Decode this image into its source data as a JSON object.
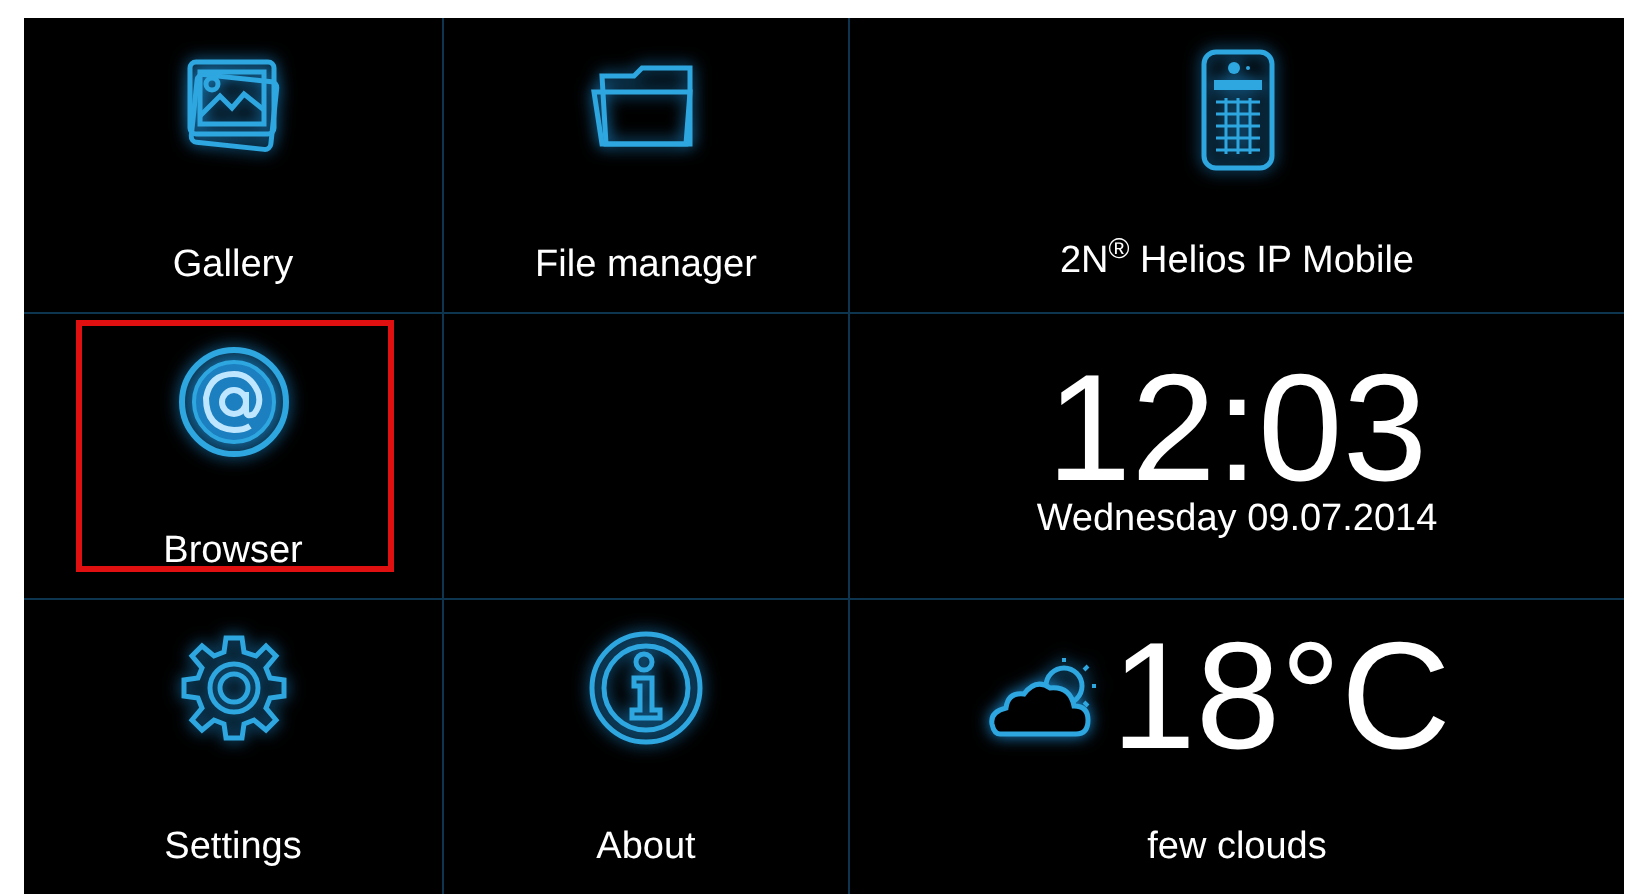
{
  "apps": [
    {
      "label": "Gallery",
      "highlighted": false
    },
    {
      "label": "File manager",
      "highlighted": false
    },
    {
      "label": "Browser",
      "highlighted": true
    },
    {
      "label": "Settings",
      "highlighted": false
    },
    {
      "label": "About",
      "highlighted": false
    }
  ],
  "device": {
    "label": "2N$^{®}$ Helios IP Mobile"
  },
  "clock": {
    "time": "12:03",
    "date": "Wednesday 09.07.2014"
  },
  "weather": {
    "temperature": "18°C",
    "condition": "few clouds"
  }
}
